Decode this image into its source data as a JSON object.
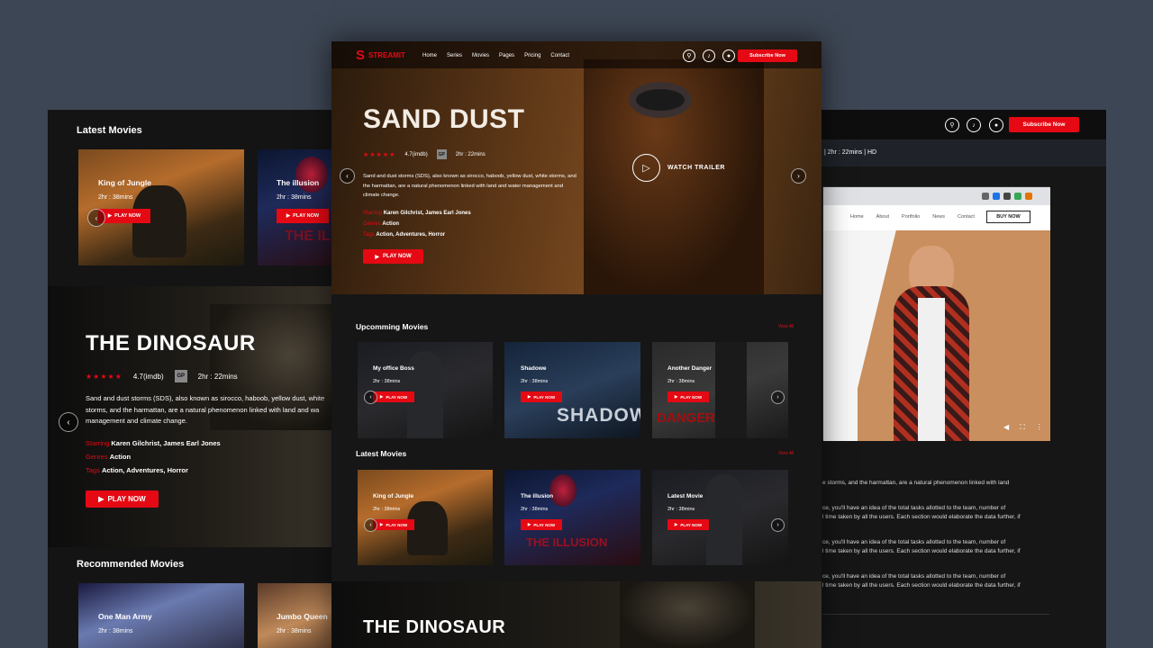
{
  "center": {
    "logo": "STREAMIT",
    "nav": [
      "Home",
      "Series",
      "Movies",
      "Pages",
      "Pricing",
      "Contact"
    ],
    "subscribe": "Subscribe Now",
    "hero": {
      "title": "SAND DUST",
      "rating": "4.7(imdb)",
      "badge": "GP",
      "duration": "2hr : 22mins",
      "desc": "Sand and dust storms (SDS), also known as sirocco, haboob, yellow dust, white storms, and the harmattan, are a natural phenomenon linked with land and water management and climate change.",
      "starring_label": "Starring",
      "starring": "Karen Gilchrist, James Earl Jones",
      "genres_label": "Genres",
      "genres": "Action",
      "tags_label": "Tags",
      "tags": "Action, Adventures, Horror",
      "play": "PLAY NOW",
      "trailer": "WATCH TRAILER"
    },
    "upcoming": {
      "title": "Upcomming Movies",
      "view_all": "View All",
      "cards": [
        {
          "title": "My office Boss",
          "duration": "2hr : 38mins",
          "play": "PLAY NOW"
        },
        {
          "title": "Shadowe",
          "duration": "2hr : 38mins",
          "play": "PLAY NOW",
          "overlay": "SHADOW"
        },
        {
          "title": "Another Danger",
          "duration": "2hr : 38mins",
          "play": "PLAY NOW",
          "overlay": "DANGER"
        }
      ]
    },
    "latest": {
      "title": "Latest Movies",
      "view_all": "View All",
      "cards": [
        {
          "title": "King of Jungle",
          "duration": "2hr : 38mins",
          "play": "PLAY NOW"
        },
        {
          "title": "The illusion",
          "duration": "2hr : 38mins",
          "play": "PLAY NOW",
          "overlay": "THE ILLUSION"
        },
        {
          "title": "Latest Movie",
          "duration": "2hr : 38mins",
          "play": "PLAY NOW"
        }
      ]
    },
    "bottom_title": "THE DINOSAUR"
  },
  "left": {
    "latest_title": "Latest Movies",
    "cards": [
      {
        "title": "King of Jungle",
        "duration": "2hr : 38mins",
        "play": "PLAY NOW"
      },
      {
        "title": "The illusion",
        "duration": "2hr : 38mins",
        "play": "PLAY NOW",
        "overlay": "THE IL"
      }
    ],
    "hero": {
      "title": "THE DINOSAUR",
      "rating": "4.7(imdb)",
      "badge": "GP",
      "duration": "2hr : 22mins",
      "desc": "Sand and dust storms (SDS), also known as sirocco, haboob, yellow dust, white storms, and the harmattan, are a natural phenomenon linked with land and wa management and climate change.",
      "starring_label": "Starring",
      "starring": "Karen Gilchrist, James Earl Jones",
      "genres_label": "Genres",
      "genres": "Action",
      "tags_label": "Tags",
      "tags": "Action, Adventures, Horror",
      "play": "PLAY NOW"
    },
    "recommended_title": "Recommended Movies",
    "rec_cards": [
      {
        "title": "One Man Army",
        "duration": "2hr : 38mins"
      },
      {
        "title": "Jumbo Queen",
        "duration": "2hr : 38mins"
      }
    ]
  },
  "right": {
    "subscribe": "Subscribe Now",
    "meta": "| 2hr : 22mins | HD",
    "browser_nav": [
      "Home",
      "About",
      "Portfolio",
      "News",
      "Contact"
    ],
    "buy_now": "BUY NOW",
    "text_lines": [
      "e storms, and the harmattan, are a natural phenomenon linked with land",
      "ce, you'll have an idea of the total tasks allotted to the team, number of",
      "l time taken by all the users. Each section would elaborate the data further, if",
      "ce, you'll have an idea of the total tasks allotted to the team, number of",
      "l time taken by all the users. Each section would elaborate the data further, if",
      "ce, you'll have an idea of the total tasks allotted to the team, number of",
      "l time taken by all the users. Each section would elaborate the data further, if"
    ]
  },
  "colors": {
    "accent": "#e50914",
    "bg": "#3d4654",
    "panel": "#141414"
  }
}
